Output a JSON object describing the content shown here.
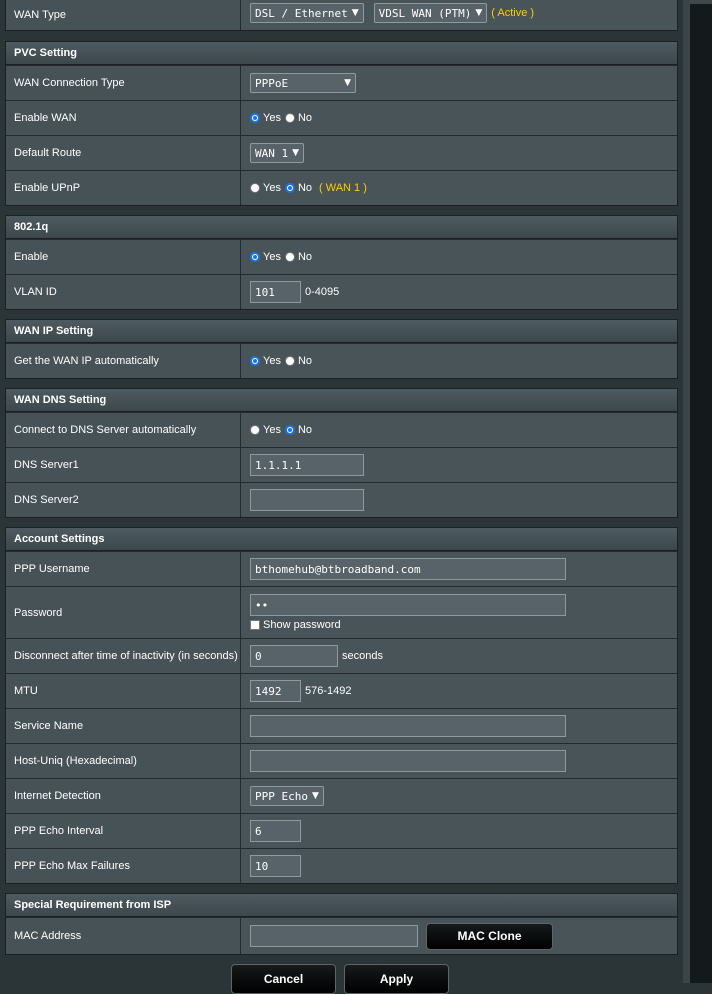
{
  "wan_type": {
    "label": "WAN Type",
    "select1": "DSL / Ethernet",
    "select2": "VDSL WAN (PTM)",
    "status": "( Active )"
  },
  "pvc": {
    "title": "PVC Setting",
    "conn_type_label": "WAN Connection Type",
    "conn_type_value": "PPPoE",
    "enable_wan_label": "Enable WAN",
    "default_route_label": "Default Route",
    "default_route_value": "WAN 1",
    "upnp_label": "Enable UPnP",
    "upnp_note": "( WAN 1 )"
  },
  "radio": {
    "yes": "Yes",
    "no": "No"
  },
  "dot1q": {
    "title": "802.1q",
    "enable_label": "Enable",
    "vlan_label": "VLAN ID",
    "vlan_value": "101",
    "vlan_range": "0-4095"
  },
  "wan_ip": {
    "title": "WAN IP Setting",
    "auto_label": "Get the WAN IP automatically"
  },
  "wan_dns": {
    "title": "WAN DNS Setting",
    "auto_label": "Connect to DNS Server automatically",
    "dns1_label": "DNS Server1",
    "dns1_value": "1.1.1.1",
    "dns2_label": "DNS Server2",
    "dns2_value": ""
  },
  "account": {
    "title": "Account Settings",
    "user_label": "PPP Username",
    "user_value": "bthomehub@btbroadband.com",
    "pass_label": "Password",
    "pass_value": "••",
    "show_pass": "Show password",
    "idle_label": "Disconnect after time of inactivity (in seconds)",
    "idle_value": "0",
    "idle_unit": "seconds",
    "mtu_label": "MTU",
    "mtu_value": "1492",
    "mtu_range": "576-1492",
    "service_label": "Service Name",
    "service_value": "",
    "hostuniq_label": "Host-Uniq (Hexadecimal)",
    "hostuniq_value": "",
    "detect_label": "Internet Detection",
    "detect_value": "PPP Echo",
    "echo_interval_label": "PPP Echo Interval",
    "echo_interval_value": "6",
    "echo_fail_label": "PPP Echo Max Failures",
    "echo_fail_value": "10"
  },
  "isp": {
    "title": "Special Requirement from ISP",
    "mac_label": "MAC Address",
    "mac_value": "",
    "mac_clone": "MAC Clone"
  },
  "actions": {
    "cancel": "Cancel",
    "apply": "Apply"
  },
  "colors": {
    "accent_gold": "#ffcc00",
    "radio_blue": "#1a73e8",
    "panel": "#495458"
  }
}
